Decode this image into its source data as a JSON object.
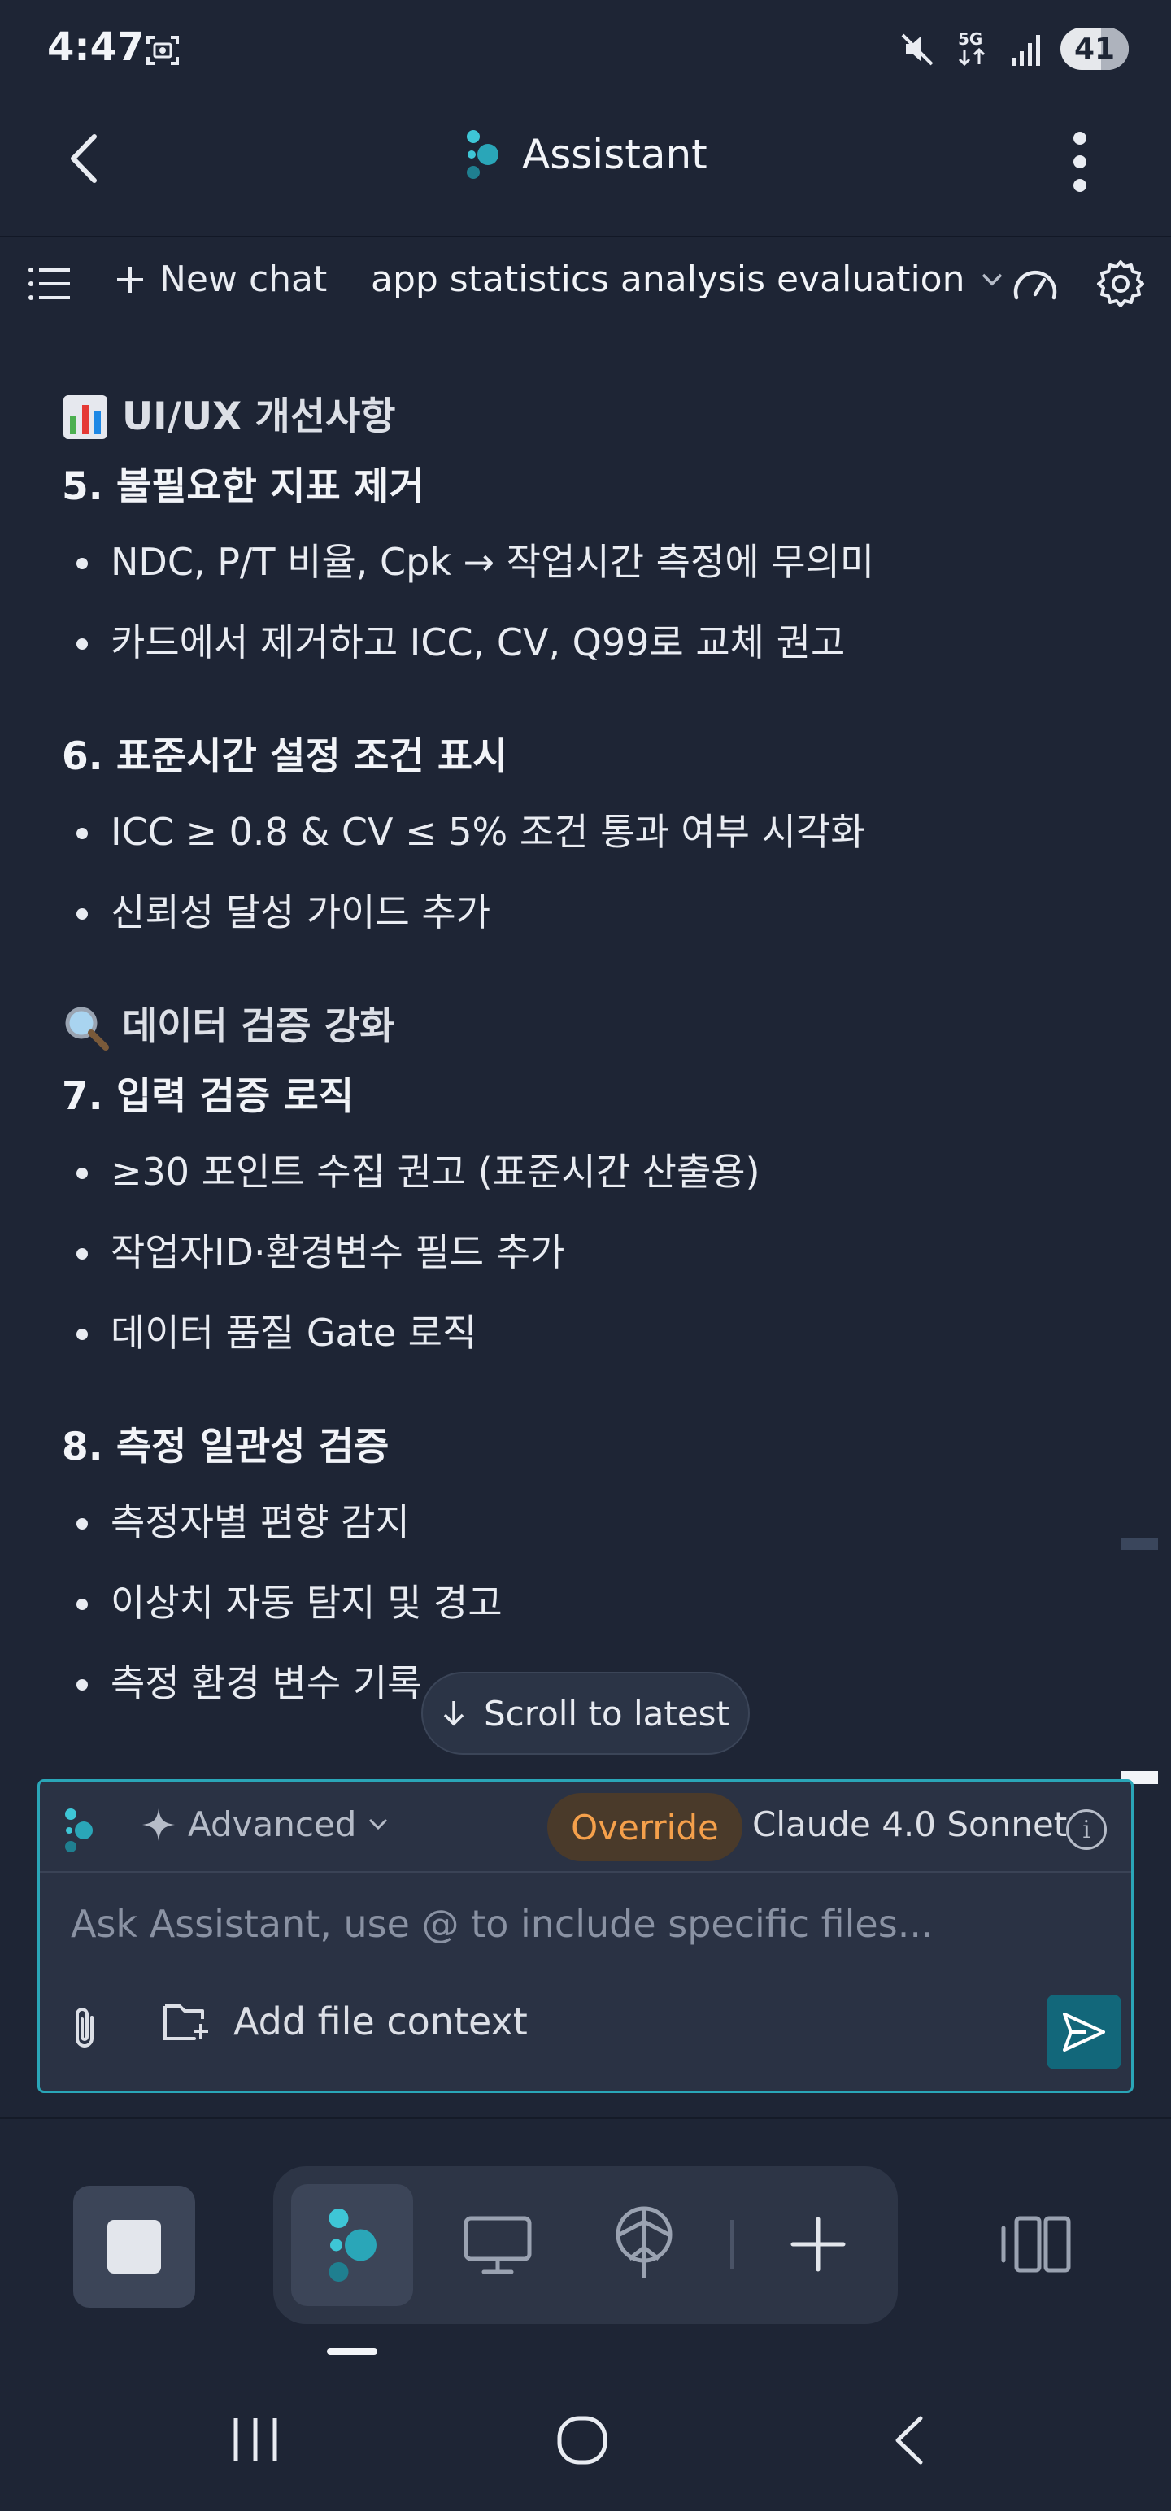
{
  "status_bar": {
    "time": "4:47",
    "battery": "41",
    "icons": [
      "screenshot-icon",
      "mute-icon",
      "5g-icon",
      "signal-icon",
      "battery-icon"
    ]
  },
  "header": {
    "title": "Assistant"
  },
  "toolbar": {
    "new_chat_label": "New chat",
    "chat_title": "app statistics analysis evaluation"
  },
  "content": {
    "section1_heading": "UI/UX 개선사항",
    "item5_title": "5. 불필요한 지표 제거",
    "item5_bullets": [
      "NDC, P/T 비율, Cpk → 작업시간 측정에 무의미",
      "카드에서 제거하고 ICC, CV, Q99로 교체 권고"
    ],
    "item6_title": "6. 표준시간 설정 조건 표시",
    "item6_bullets": [
      "ICC ≥ 0.8 & CV ≤ 5% 조건 통과 여부 시각화",
      "신뢰성 달성 가이드 추가"
    ],
    "section2_heading": "데이터 검증 강화",
    "item7_title": "7. 입력 검증 로직",
    "item7_bullets": [
      "≥30 포인트 수집 권고 (표준시간 산출용)",
      "작업자ID·환경변수 필드 추가",
      "데이터 품질 Gate 로직"
    ],
    "item8_title": "8. 측정 일관성 검증",
    "item8_bullets": [
      "측정자별 편향 감지",
      "이상치 자동 탐지 및 경고",
      "측정 환경 변수 기록"
    ]
  },
  "scroll_latest_label": "Scroll to latest",
  "composer": {
    "mode_label": "Advanced",
    "override_label": "Override",
    "model_label": "Claude 4.0 Sonnet",
    "placeholder": "Ask Assistant, use @ to include specific files...",
    "add_file_label": "Add file context"
  },
  "colors": {
    "background": "#1e2535",
    "accent": "#2aa6b8",
    "override": "#f5a04b",
    "send": "#12677a"
  }
}
